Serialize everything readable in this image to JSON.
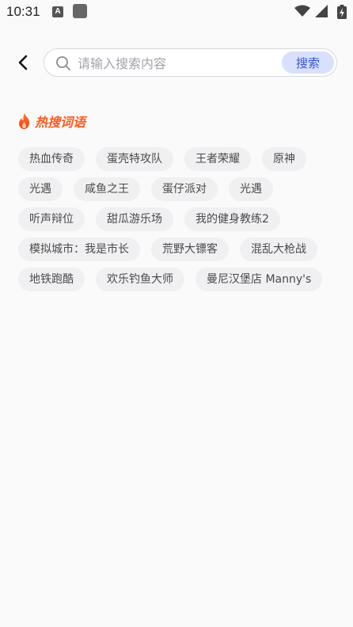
{
  "status_bar": {
    "time": "10:31",
    "notification_icon_letter": "A",
    "icons": [
      "wifi-icon",
      "signal-icon",
      "battery-charging-icon"
    ]
  },
  "search": {
    "placeholder": "请输入搜索内容",
    "value": "",
    "button_label": "搜索"
  },
  "hot": {
    "title": "热搜词语",
    "icon": "fire-icon",
    "accent_color": "#ff5a1f",
    "tags": [
      "热血传奇",
      "蛋壳特攻队",
      "王者荣耀",
      "原神",
      "光遇",
      "咸鱼之王",
      "蛋仔派对",
      "光遇",
      "听声辩位",
      "甜瓜游乐场",
      "我的健身教练2",
      "模拟城市：我是市长",
      "荒野大镖客",
      "混乱大枪战",
      "地铁跑酷",
      "欢乐钓鱼大师",
      "曼尼汉堡店 Manny's"
    ]
  },
  "colors": {
    "background": "#fafafa",
    "search_button_bg": "#d9e0fb",
    "search_button_text": "#3353d9",
    "tag_bg": "#f0f0f2"
  }
}
